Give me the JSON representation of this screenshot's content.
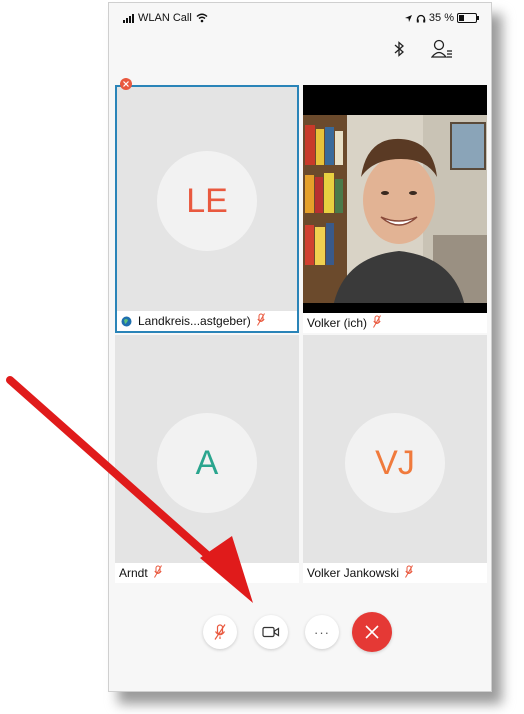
{
  "status_bar": {
    "carrier": "WLAN Call",
    "battery_text": "35 %"
  },
  "participants": [
    {
      "initials": "LE",
      "name": "Landkreis...astgeber)",
      "initials_color": "#e9593f",
      "selected": true
    },
    {
      "initials": "",
      "name": "Volker (ich)",
      "video": true
    },
    {
      "initials": "A",
      "name": "Arndt",
      "initials_color": "#2aa58e"
    },
    {
      "initials": "VJ",
      "name": "Volker Jankowski",
      "initials_color": "#f07a3c"
    }
  ],
  "controls": {
    "mute_icon": "mic-off-icon",
    "video_icon": "camera-icon",
    "more_label": "···",
    "hangup_icon": "close-icon",
    "hangup_color": "#e53935"
  },
  "colors": {
    "accent_border": "#2a84b8",
    "mic_off": "#e9593f",
    "arrow": "#e01b1b"
  }
}
